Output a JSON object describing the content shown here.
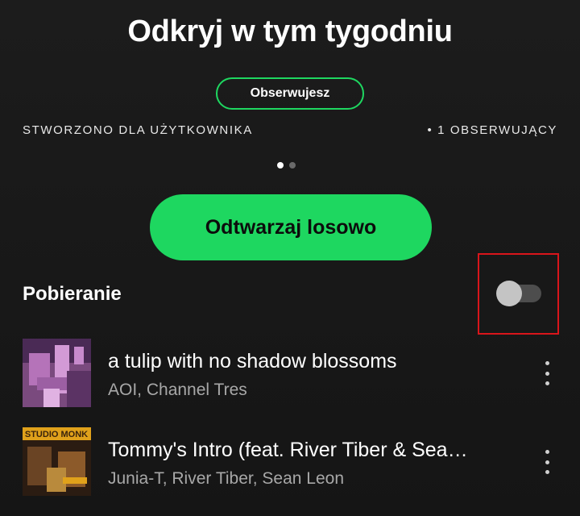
{
  "playlist": {
    "title": "Odkryj w tym tygodniu",
    "follow_label": "Obserwujesz",
    "created_for": "STWORZONO DLA UŻYTKOWNIKA",
    "followers": "• 1 OBSERWUJĄCY",
    "page_dots": {
      "total": 2,
      "active": 1
    }
  },
  "shuffle_label": "Odtwarzaj losowo",
  "download": {
    "label": "Pobieranie",
    "enabled": false
  },
  "tracks": [
    {
      "title": "a tulip with no shadow blossoms",
      "artists": "AOI, Channel Tres",
      "cover_icon": "album-cover-purple"
    },
    {
      "title": "Tommy's Intro (feat. River Tiber & Sea…",
      "artists": "Junia-T, River Tiber, Sean Leon",
      "cover_icon": "album-cover-studio-monk",
      "cover_text": "STUDIO MONK"
    }
  ],
  "colors": {
    "accent": "#1ed760",
    "background": "#181818",
    "highlight": "#d9151b",
    "secondary_text": "#a8a8a8"
  }
}
